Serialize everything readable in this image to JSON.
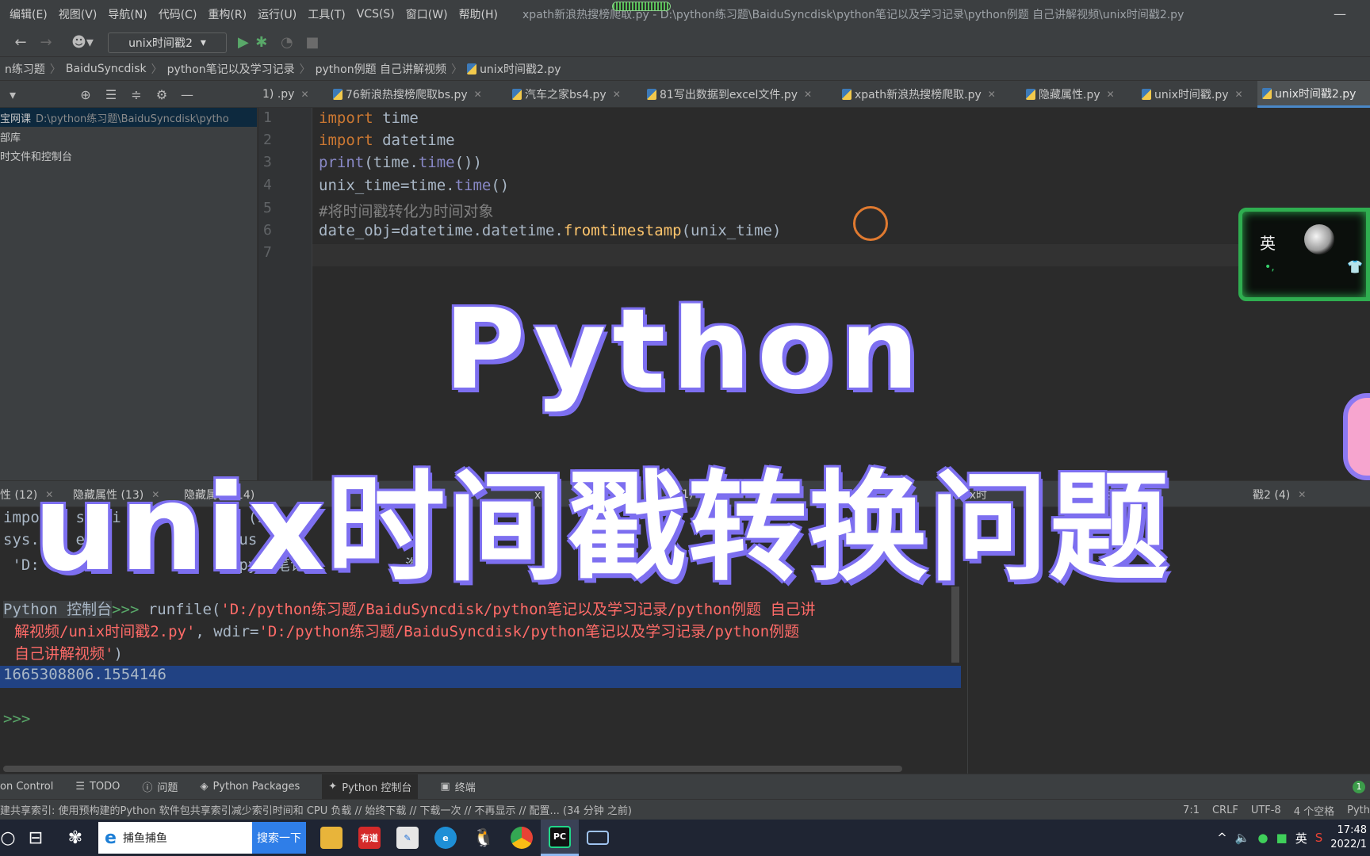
{
  "menubar": {
    "items": [
      "编辑(E)",
      "视图(V)",
      "导航(N)",
      "代码(C)",
      "重构(R)",
      "运行(U)",
      "工具(T)",
      "VCS(S)",
      "窗口(W)",
      "帮助(H)"
    ],
    "window_title": "xpath新浪热搜榜爬取.py - D:\\python练习题\\BaiduSyncdisk\\python笔记以及学习记录\\python例题 自己讲解视频\\unix时间戳2.py"
  },
  "toolbar": {
    "back_icon": "back-arrow-icon",
    "forward_icon": "forward-arrow-icon",
    "run_config": "unix时间戳2"
  },
  "breadcrumb": {
    "items": [
      "n练习题",
      "BaiduSyncdisk",
      "python笔记以及学习记录",
      "python例题 自己讲解视频",
      "unix时间戳2.py"
    ]
  },
  "tabs": [
    {
      "label": "1) .py"
    },
    {
      "label": "76新浪热搜榜爬取bs.py"
    },
    {
      "label": "汽车之家bs4.py"
    },
    {
      "label": "81写出数据到excel文件.py"
    },
    {
      "label": "xpath新浪热搜榜爬取.py"
    },
    {
      "label": "隐藏属性.py"
    },
    {
      "label": "unix时间戳.py"
    },
    {
      "label": "unix时间戳2.py",
      "active": true
    }
  ],
  "project": {
    "rows": [
      {
        "name": "宝网课",
        "path": "D:\\python练习题\\BaiduSyncdisk\\pytho"
      },
      {
        "name": "部库",
        "path": ""
      },
      {
        "name": "时文件和控制台",
        "path": ""
      }
    ]
  },
  "editor": {
    "line_numbers": [
      "1",
      "2",
      "3",
      "4",
      "5",
      "6",
      "7"
    ],
    "lines": {
      "l1": {
        "kw": "import",
        "rest": " time"
      },
      "l2": {
        "kw": "import",
        "rest": " datetime"
      },
      "l3": {
        "a": "print",
        "b": "(time.",
        "c": "time",
        "d": "())"
      },
      "l4": {
        "a": "unix_time=time.",
        "b": "time",
        "c": "()"
      },
      "l5": {
        "comment": "#将时间戳转化为时间对象"
      },
      "l6": {
        "a": "date_obj=datetime.datetime.",
        "b": "fromtimestamp",
        "c": "(unix_time)"
      }
    }
  },
  "widget": {
    "ime": "英"
  },
  "bottom_tabs": [
    {
      "label": "性 (12)"
    },
    {
      "label": "隐藏属性 (13)"
    },
    {
      "label": "隐藏属性 (14)"
    },
    {
      "label": "隐"
    },
    {
      "label": "x时"
    },
    {
      "label": "1)"
    },
    {
      "label": "nix时"
    },
    {
      "label": "时间"
    },
    {
      "label": "戳2 (4)"
    }
  ],
  "console": {
    "hidden_lines": [
      "impo    s  ii   ython      (sy        s",
      "sys.    e      e        idus         ",
      " 'D:                     /py  笔记           淘"
    ],
    "prompt_label": "Python 控制台",
    "prompt": ">>>",
    "cmd_a": " runfile(",
    "cmd_path1": "'D:/python练习题/BaiduSyncdisk/python笔记以及学习记录/python例题 自己讲",
    "cmd_path2": "解视频/unix时间戳2.py'",
    "cmd_mid": ", wdir=",
    "cmd_path3": "'D:/python练习题/BaiduSyncdisk/python笔记以及学习记录/python例题",
    "cmd_path4": "自己讲解视频'",
    "cmd_end": ")",
    "output": "1665308806.1554146",
    "empty_prompt": ">>>"
  },
  "toolwindows": {
    "items": [
      "on Control",
      "TODO",
      "问题",
      "Python Packages",
      "Python 控制台",
      "终端"
    ],
    "badge": "1"
  },
  "status": {
    "message": "建共享索引: 使用预构建的Python 软件包共享索引减少索引时间和 CPU 负载 // 始终下载 // 下载一次 // 不再显示 // 配置... (34 分钟 之前)",
    "position": "7:1",
    "line_sep": "CRLF",
    "encoding": "UTF-8",
    "indent": "4 个空格",
    "interpreter": "Pyth"
  },
  "taskbar": {
    "search_text": "捕鱼捕鱼",
    "search_button": "搜索一下",
    "youdao": "有道",
    "ime": "英",
    "time": "17:48",
    "date": "2022/1"
  },
  "overlay": {
    "line1": "Python",
    "line2": "unix时间戳转换问题"
  },
  "colors": {
    "ide_bg": "#2b2b2b",
    "panel_bg": "#3c3f41",
    "keyword": "#cc7832",
    "function": "#ffc66d",
    "builtin": "#8888c6",
    "string": "#ff6b68",
    "selection": "#214283",
    "overlay_outline": "#7d6ff0",
    "accent_blue": "#4a88c7"
  }
}
